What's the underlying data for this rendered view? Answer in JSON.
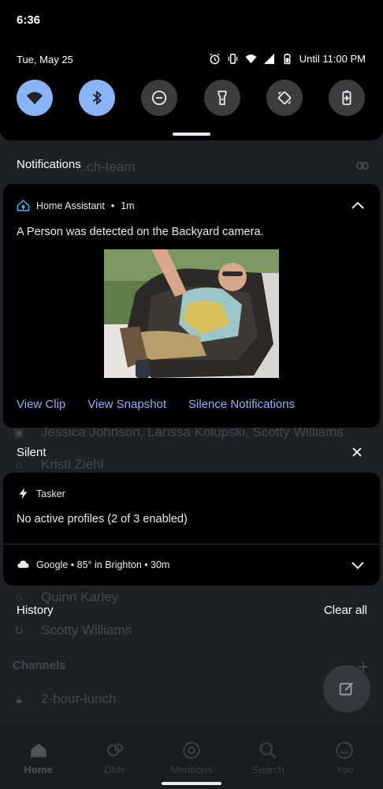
{
  "status_bar": {
    "time": "6:36",
    "date": "Tue, May 25",
    "dnd_until": "Until 11:00 PM"
  },
  "quick_settings": [
    {
      "name": "wifi",
      "active": true
    },
    {
      "name": "bluetooth",
      "active": true
    },
    {
      "name": "do-not-disturb",
      "active": false
    },
    {
      "name": "flashlight",
      "active": false
    },
    {
      "name": "auto-rotate",
      "active": false
    },
    {
      "name": "battery-saver",
      "active": false
    }
  ],
  "notifications_label": "Notifications",
  "home_assistant": {
    "app_name": "Home Assistant",
    "time": "1m",
    "message": "A Person was detected on the Backyard camera.",
    "actions": [
      "View Clip",
      "View Snapshot",
      "Silence Notifications"
    ]
  },
  "silent_label": "Silent",
  "tasker": {
    "app_name": "Tasker",
    "message": "No active profiles (2 of 3 enabled)"
  },
  "google": {
    "summary": "Google • 85° in Brighton • 30m"
  },
  "history_label": "History",
  "clear_all_label": "Clear all",
  "background_app": {
    "rows": [
      {
        "text": "...ch-team"
      },
      {
        "text": "Jessica Johnson, Larissa Kolupski, Scotty Williams"
      },
      {
        "text": "Kristi Ziehl"
      },
      {
        "text": "Quinn Karley"
      },
      {
        "text": "Scotty Williams"
      },
      {
        "text": "2-hour-lunch"
      }
    ],
    "channels_label": "Channels",
    "nav": [
      "Home",
      "DMs",
      "Mentions",
      "Search",
      "You"
    ]
  },
  "colors": {
    "accent": "#8ab4f8",
    "shade_bg": "#000000",
    "tile_off": "#3c3c3c"
  }
}
